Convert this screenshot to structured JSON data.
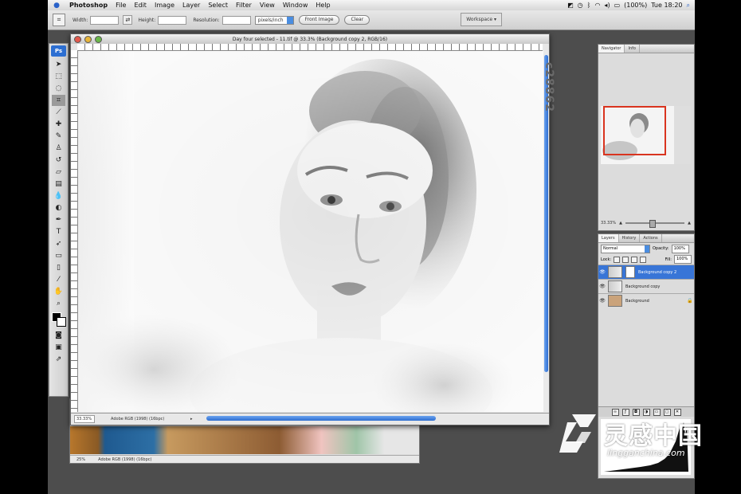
{
  "menubar": {
    "app_name": "Photoshop",
    "items": [
      "File",
      "Edit",
      "Image",
      "Layer",
      "Select",
      "Filter",
      "View",
      "Window",
      "Help"
    ],
    "battery": "(100%)",
    "clock": "Tue 18:20"
  },
  "options_bar": {
    "width_label": "Width:",
    "height_label": "Height:",
    "resolution_label": "Resolution:",
    "unit_select": "pixels/inch",
    "front_image_button": "Front Image",
    "clear_button": "Clear",
    "workspace_button": "Workspace ▾"
  },
  "document": {
    "title": "Day four selected - 11.tif @ 33.3% (Background copy 2, RGB/16)",
    "zoom": "33.33%",
    "doc_info": "Adobe RGB (1998) (16bpc)"
  },
  "background_document": {
    "zoom": "25%",
    "doc_info": "Adobe RGB (1998) (16bpc)"
  },
  "side_watermark": "c28862",
  "navigator": {
    "tabs": [
      "Navigator",
      "Info"
    ],
    "zoom": "33.33%"
  },
  "layers_panel": {
    "tabs": [
      "Layers",
      "History",
      "Actions"
    ],
    "blend_mode": "Normal",
    "opacity_label": "Opacity:",
    "opacity_value": "100%",
    "lock_label": "Lock:",
    "fill_label": "Fill:",
    "fill_value": "100%",
    "layers": [
      {
        "name": "Background copy 2",
        "selected": true
      },
      {
        "name": "Background copy",
        "selected": false
      },
      {
        "name": "Background",
        "selected": false
      }
    ]
  },
  "brand": {
    "name": "灵感中国",
    "url": "lingganchina.com"
  },
  "colors": {
    "selection_blue": "#3875d7",
    "scrollbar_blue": "#2e6ed1",
    "proxy_red": "#d9341f"
  }
}
